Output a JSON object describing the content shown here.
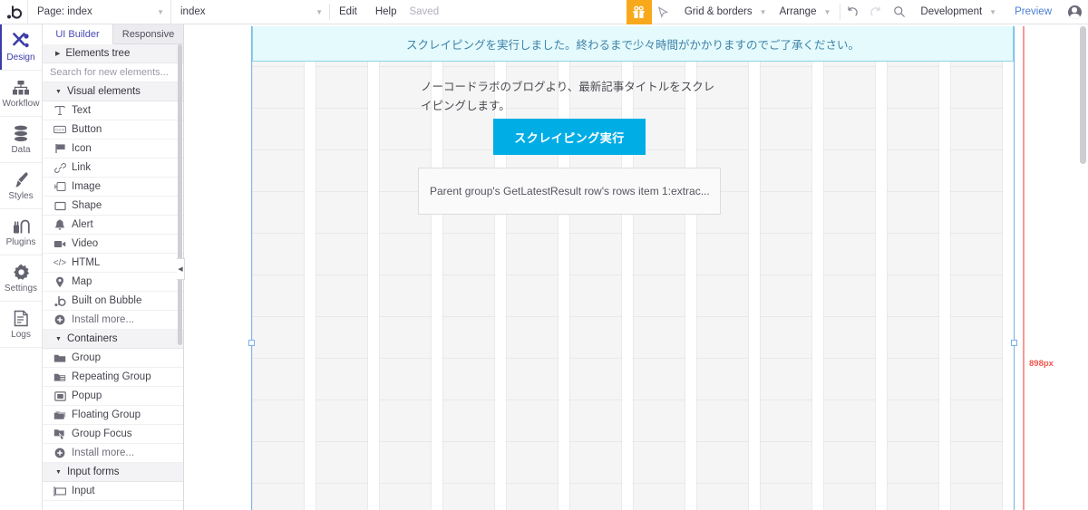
{
  "topbar": {
    "logo": "b",
    "page_selector": "Page: index",
    "page_name": "index",
    "edit_label": "Edit",
    "help_label": "Help",
    "saved_label": "Saved",
    "gift_icon": "gift-icon",
    "pointer_icon": "pointer-icon",
    "grid_borders": "Grid & borders",
    "arrange": "Arrange",
    "undo_icon": "undo-icon",
    "redo_icon": "redo-icon",
    "search_icon": "search-icon",
    "environment": "Development",
    "preview_label": "Preview",
    "avatar": "user-avatar",
    "accent_orange": "#f8a91b",
    "link_blue": "#4a7fd4"
  },
  "rail": {
    "items": [
      {
        "label": "Design",
        "icon": "design-icon",
        "active": true
      },
      {
        "label": "Workflow",
        "icon": "workflow-icon",
        "active": false
      },
      {
        "label": "Data",
        "icon": "data-icon",
        "active": false
      },
      {
        "label": "Styles",
        "icon": "styles-icon",
        "active": false
      },
      {
        "label": "Plugins",
        "icon": "plugins-icon",
        "active": false
      },
      {
        "label": "Settings",
        "icon": "settings-icon",
        "active": false
      },
      {
        "label": "Logs",
        "icon": "logs-icon",
        "active": false
      }
    ],
    "active_color": "#3c3ca8"
  },
  "panel": {
    "tabs": [
      {
        "label": "UI Builder",
        "active": true
      },
      {
        "label": "Responsive",
        "active": false
      }
    ],
    "elements_tree": "Elements tree",
    "search_placeholder": "Search for new elements...",
    "sections": [
      {
        "title": "Visual elements",
        "items": [
          {
            "label": "Text",
            "icon": "text-icon"
          },
          {
            "label": "Button",
            "icon": "button-icon"
          },
          {
            "label": "Icon",
            "icon": "flag-icon"
          },
          {
            "label": "Link",
            "icon": "link-icon"
          },
          {
            "label": "Image",
            "icon": "image-icon"
          },
          {
            "label": "Shape",
            "icon": "shape-icon"
          },
          {
            "label": "Alert",
            "icon": "bell-icon"
          },
          {
            "label": "Video",
            "icon": "video-icon"
          },
          {
            "label": "HTML",
            "icon": "code-icon"
          },
          {
            "label": "Map",
            "icon": "map-pin-icon"
          },
          {
            "label": "Built on Bubble",
            "icon": "bubble-logo-icon"
          },
          {
            "label": "Install more...",
            "icon": "plus-circle-icon"
          }
        ]
      },
      {
        "title": "Containers",
        "items": [
          {
            "label": "Group",
            "icon": "folder-icon"
          },
          {
            "label": "Repeating Group",
            "icon": "repeating-group-icon"
          },
          {
            "label": "Popup",
            "icon": "popup-icon"
          },
          {
            "label": "Floating Group",
            "icon": "floating-group-icon"
          },
          {
            "label": "Group Focus",
            "icon": "group-focus-icon"
          },
          {
            "label": "Install more...",
            "icon": "plus-circle-icon"
          }
        ]
      },
      {
        "title": "Input forms",
        "items": [
          {
            "label": "Input",
            "icon": "input-icon"
          }
        ]
      }
    ],
    "collapse_icon": "collapse-left-icon"
  },
  "canvas": {
    "alert_text": "スクレイピングを実行しました。終わるまで少々時間がかかりますのでご了承ください。",
    "alert_bg": "#e4fafc",
    "alert_border": "#8ed4e3",
    "description": "ノーコードラボのブログより、最新記事タイトルをスクレイピングします。",
    "run_button": "スクレイピング実行",
    "run_button_bg": "#00ade5",
    "result_text": "Parent group's GetLatestResult row's rows item 1:extrac...",
    "width_label": "898px",
    "width_label_color": "#f0564e"
  }
}
